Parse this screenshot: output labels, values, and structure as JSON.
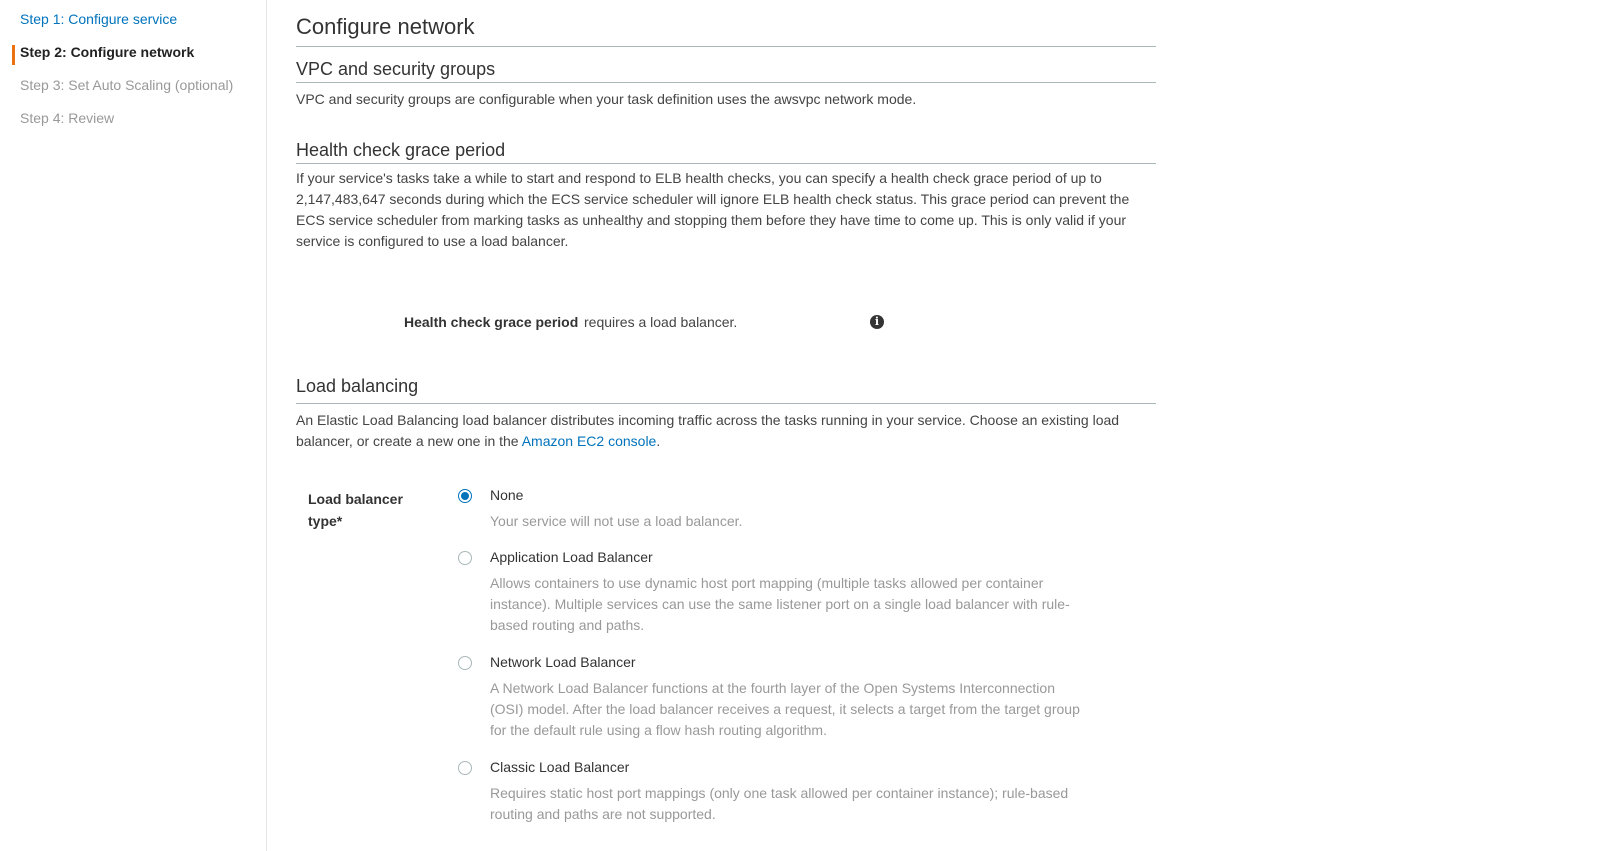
{
  "sidebar": {
    "steps": [
      {
        "label": "Step 1: Configure service",
        "state": "done"
      },
      {
        "label": "Step 2: Configure network",
        "state": "active"
      },
      {
        "label": "Step 3: Set Auto Scaling (optional)",
        "state": "future"
      },
      {
        "label": "Step 4: Review",
        "state": "future"
      }
    ]
  },
  "main": {
    "title": "Configure network",
    "vpc": {
      "heading": "VPC and security groups",
      "text": "VPC and security groups are configurable when your task definition uses the awsvpc network mode."
    },
    "health": {
      "heading": "Health check grace period",
      "text": "If your service's tasks take a while to start and respond to ELB health checks, you can specify a health check grace period of up to 2,147,483,647 seconds during which the ECS service scheduler will ignore ELB health check status. This grace period can prevent the ECS service scheduler from marking tasks as unhealthy and stopping them before they have time to come up. This is only valid if your service is configured to use a load balancer.",
      "field_label": "Health check grace period",
      "field_value": "requires a load balancer.",
      "info_icon": "info-icon"
    },
    "load_balancing": {
      "heading": "Load balancing",
      "text_before": "An Elastic Load Balancing load balancer distributes incoming traffic across the tasks running in your service. Choose an existing load balancer, or create a new one in the ",
      "link": "Amazon EC2 console",
      "text_after": ".",
      "field_label": "Load balancer type*",
      "selected": "None",
      "options": [
        {
          "title": "None",
          "description": "Your service will not use a load balancer."
        },
        {
          "title": "Application Load Balancer",
          "description": "Allows containers to use dynamic host port mapping (multiple tasks allowed per container instance). Multiple services can use the same listener port on a single load balancer with rule-based routing and paths."
        },
        {
          "title": "Network Load Balancer",
          "description": "A Network Load Balancer functions at the fourth layer of the Open Systems Interconnection (OSI) model. After the load balancer receives a request, it selects a target from the target group for the default rule using a flow hash routing algorithm."
        },
        {
          "title": "Classic Load Balancer",
          "description": "Requires static host port mappings (only one task allowed per container instance); rule-based routing and paths are not supported."
        }
      ]
    }
  },
  "colors": {
    "link": "#0073bb",
    "active_marker": "#ec7211",
    "muted": "#999999"
  }
}
